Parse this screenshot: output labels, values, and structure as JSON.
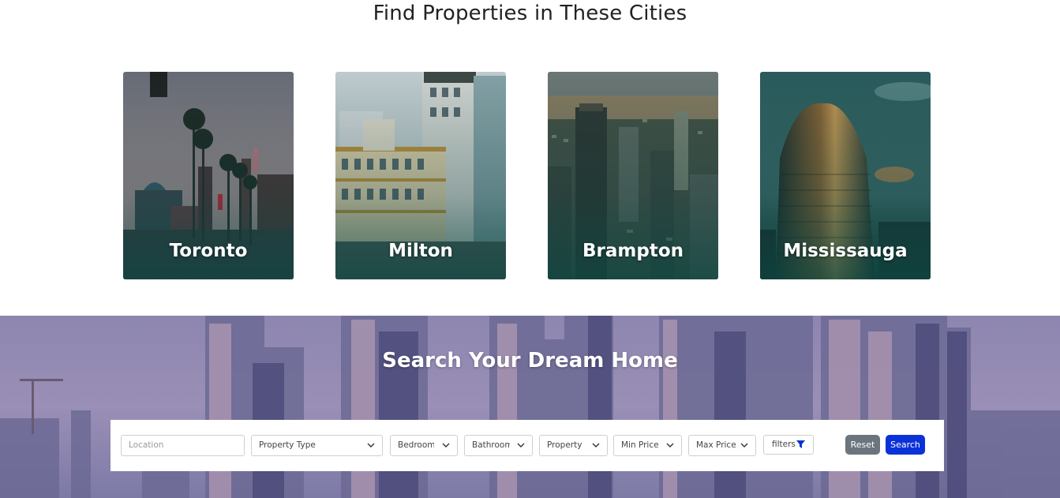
{
  "cities_section": {
    "title": "Find Properties in These Cities",
    "cities": [
      {
        "name": "Toronto"
      },
      {
        "name": "Milton"
      },
      {
        "name": "Brampton"
      },
      {
        "name": "Mississauga"
      }
    ]
  },
  "search_section": {
    "title": "Search Your Dream Home",
    "location_placeholder": "Location",
    "property_type": "Property Type",
    "bedrooms": "Bedroom:",
    "bathrooms": "Bathroom",
    "property_status": "Property S",
    "min_price": "Min Price",
    "max_price": "Max Price",
    "filters_label": "filters",
    "filters_icon": "filter-funnel-icon",
    "reset_label": "Reset",
    "search_label": "Search"
  },
  "colors": {
    "search_button": "#0b32d8",
    "reset_button": "#6c757d",
    "filter_icon": "#0b32d8"
  }
}
